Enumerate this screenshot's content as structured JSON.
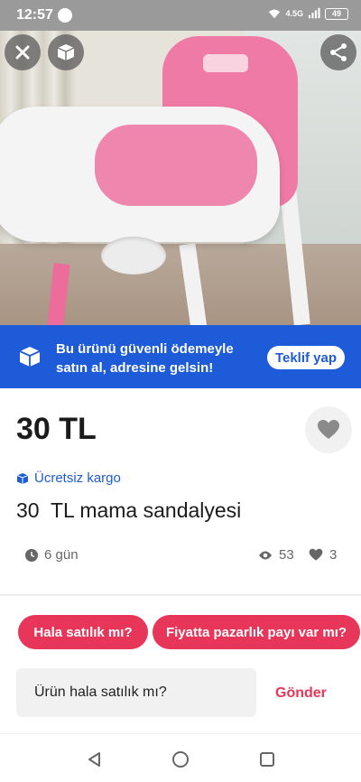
{
  "status_bar": {
    "time": "12:57",
    "network": "4.5G",
    "battery": "49"
  },
  "hero": {
    "icons": [
      "close-icon",
      "box-icon",
      "share-icon"
    ],
    "carousel_count": 3,
    "carousel_active_index": 0
  },
  "banner": {
    "text_line1": "Bu ürünü güvenli ödemeyle",
    "text_line2": "satın al, adresine gelsin!",
    "offer_label": "Teklif yap",
    "color": "#1d5bd8"
  },
  "product": {
    "price": "30 TL",
    "shipping": "Ücretsiz kargo",
    "title": "30  TL mama sandalyesi",
    "age": "6 gün",
    "views": "53",
    "likes": "3"
  },
  "chat": {
    "quick_replies": [
      "Hala satılık mı?",
      "Fiyatta pazarlık payı var mı?"
    ],
    "input_value": "Ürün hala satılık mı?",
    "send_label": "Gönder",
    "accent": "#e8365a"
  },
  "nav": {
    "icons": [
      "back-icon",
      "home-icon",
      "recents-icon"
    ]
  }
}
